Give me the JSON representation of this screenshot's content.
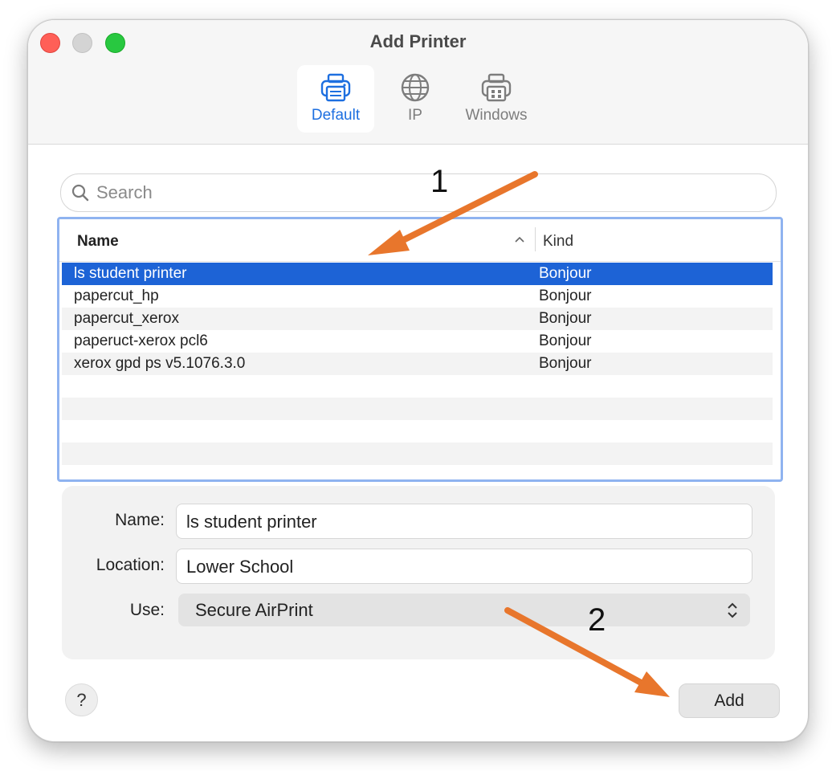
{
  "window": {
    "title": "Add Printer"
  },
  "tabs": [
    {
      "label": "Default",
      "icon": "printer-icon",
      "selected": true
    },
    {
      "label": "IP",
      "icon": "globe-icon",
      "selected": false
    },
    {
      "label": "Windows",
      "icon": "windows-printer-icon",
      "selected": false
    }
  ],
  "search": {
    "placeholder": "Search",
    "value": ""
  },
  "table": {
    "columns": {
      "name": "Name",
      "kind": "Kind"
    },
    "rows": [
      {
        "name": "ls student printer",
        "kind": "Bonjour",
        "selected": true
      },
      {
        "name": "papercut_hp",
        "kind": "Bonjour"
      },
      {
        "name": "papercut_xerox",
        "kind": "Bonjour"
      },
      {
        "name": "paperuct-xerox pcl6",
        "kind": "Bonjour"
      },
      {
        "name": "xerox gpd ps v5.1076.3.0",
        "kind": "Bonjour"
      }
    ]
  },
  "form": {
    "name_label": "Name:",
    "name_value": "ls student printer",
    "location_label": "Location:",
    "location_value": "Lower School",
    "use_label": "Use:",
    "use_value": "Secure AirPrint"
  },
  "buttons": {
    "help": "?",
    "add": "Add"
  },
  "annotations": {
    "step1": "1",
    "step2": "2",
    "arrow_color": "#e8762c"
  },
  "colors": {
    "accent": "#1d63d6",
    "selection": "#1d63d6"
  }
}
